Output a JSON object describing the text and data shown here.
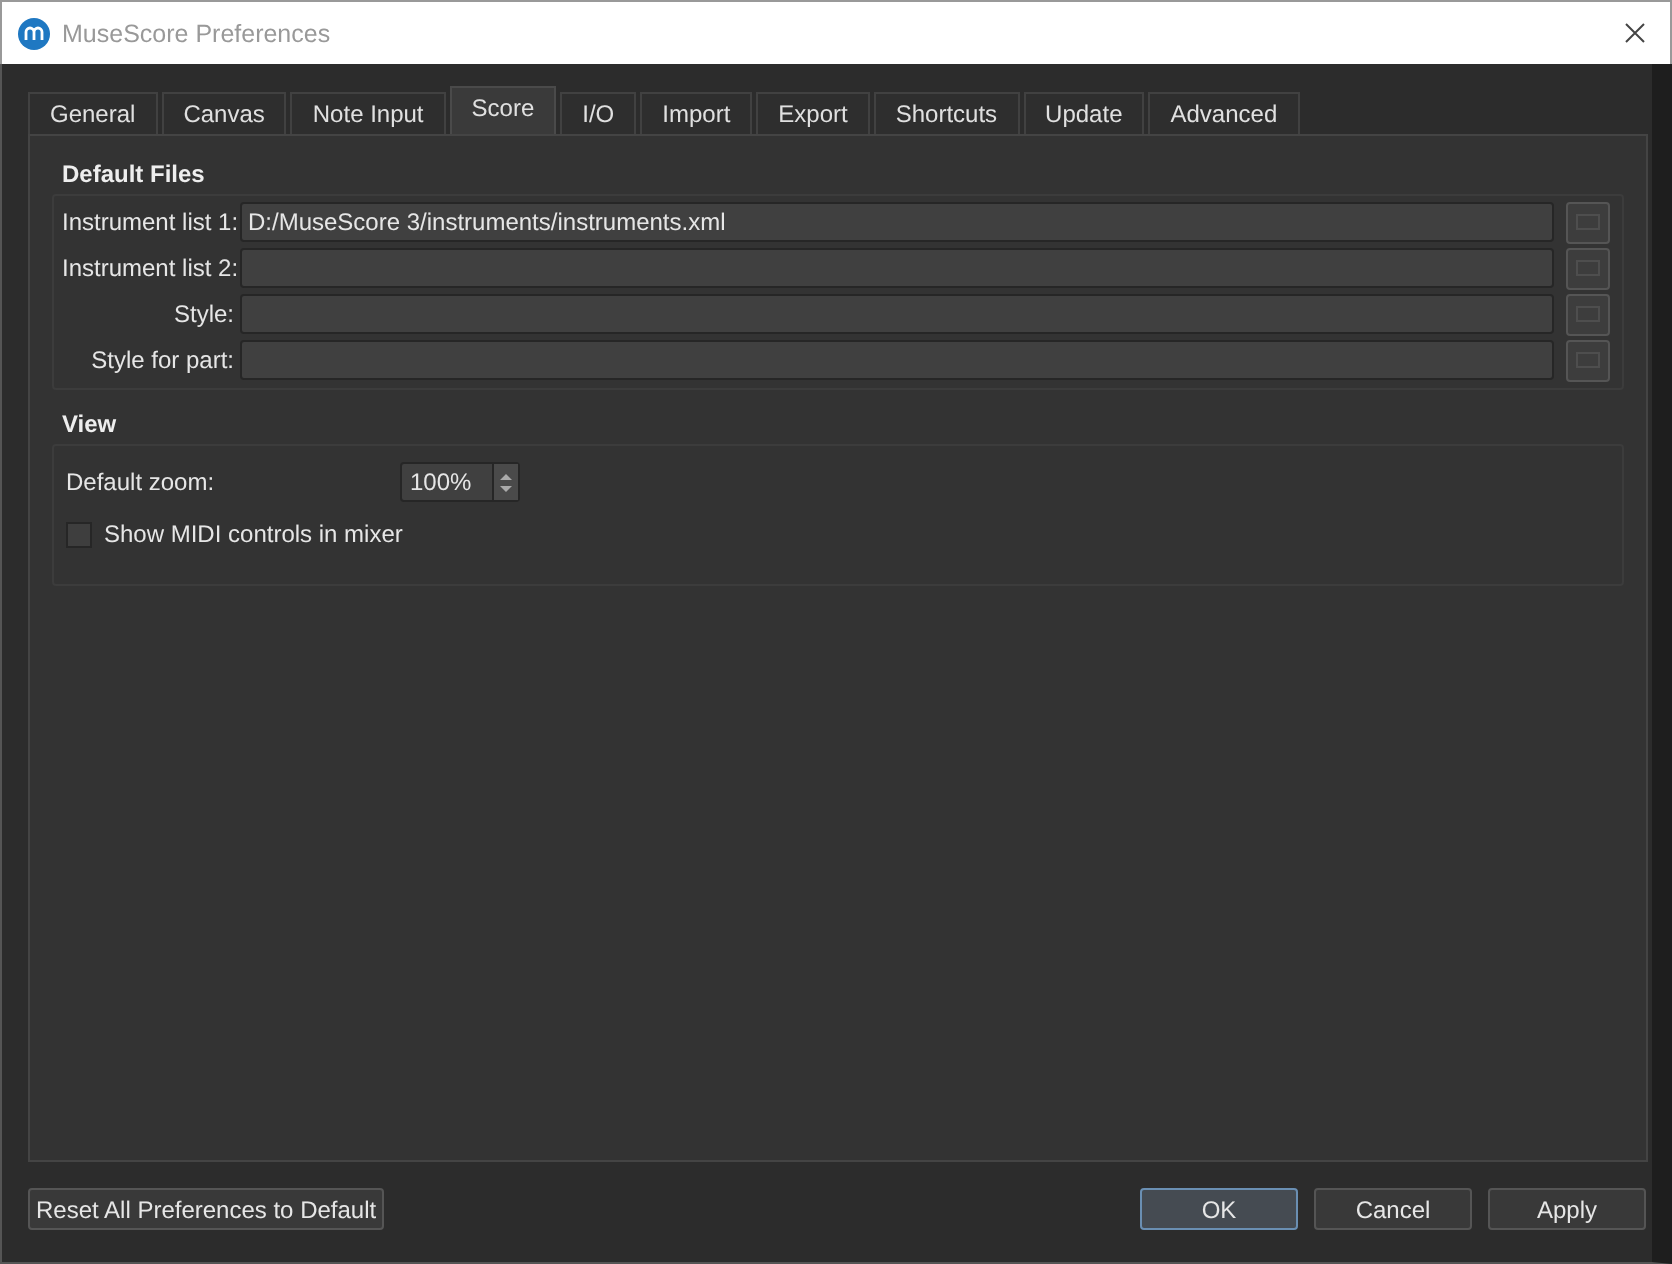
{
  "window": {
    "title": "MuseScore Preferences"
  },
  "tabs": [
    {
      "label": "General",
      "selected": false
    },
    {
      "label": "Canvas",
      "selected": false
    },
    {
      "label": "Note Input",
      "selected": false
    },
    {
      "label": "Score",
      "selected": true
    },
    {
      "label": "I/O",
      "selected": false
    },
    {
      "label": "Import",
      "selected": false
    },
    {
      "label": "Export",
      "selected": false
    },
    {
      "label": "Shortcuts",
      "selected": false
    },
    {
      "label": "Update",
      "selected": false
    },
    {
      "label": "Advanced",
      "selected": false
    }
  ],
  "default_files": {
    "title": "Default Files",
    "rows": [
      {
        "label": "Instrument list 1:",
        "value": "D:/MuseScore 3/instruments/instruments.xml"
      },
      {
        "label": "Instrument list 2:"
      },
      {
        "label": "Style:"
      },
      {
        "label": "Style for part:"
      }
    ]
  },
  "view": {
    "title": "View",
    "default_zoom": {
      "label": "Default zoom:",
      "value": "100%"
    },
    "midi_controls": {
      "label": "Show MIDI controls in mixer",
      "checked": false
    }
  },
  "reset_button": {
    "label": "Reset All Preferences to Default"
  },
  "buttons": [
    {
      "label": "OK",
      "default": true
    },
    {
      "label": "Cancel",
      "default": false
    },
    {
      "label": "Apply",
      "default": false
    }
  ]
}
